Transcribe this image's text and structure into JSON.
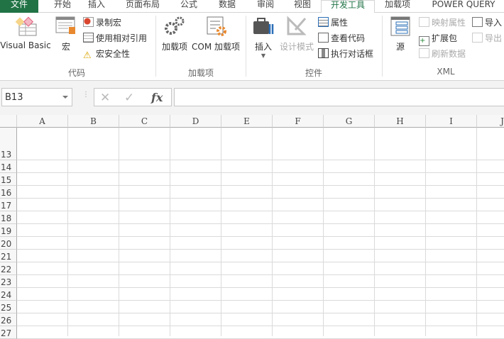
{
  "tabs": [
    "文件",
    "开始",
    "插入",
    "页面布局",
    "公式",
    "数据",
    "审阅",
    "视图",
    "开发工具",
    "加载项",
    "POWER QUERY"
  ],
  "active_tab": "开发工具",
  "ribbon": {
    "code": {
      "label": "代码",
      "visual_basic": "Visual Basic",
      "macros": "宏",
      "record_macro": "录制宏",
      "relative_ref": "使用相对引用",
      "macro_security": "宏安全性"
    },
    "addins": {
      "label": "加载项",
      "addins": "加载项",
      "com_addins": "COM 加载项"
    },
    "controls": {
      "label": "控件",
      "insert": "插入",
      "design_mode": "设计模式",
      "properties": "属性",
      "view_code": "查看代码",
      "run_dialog": "执行对话框"
    },
    "xml": {
      "label": "XML",
      "source": "源",
      "map_props": "映射属性",
      "expansion_packs": "扩展包",
      "refresh_data": "刷新数据",
      "import": "导入",
      "export": "导出"
    }
  },
  "formula_bar": {
    "name_box": "B13",
    "cancel": "✕",
    "enter": "✓",
    "fx": "fx",
    "value": ""
  },
  "columns": [
    "A",
    "B",
    "C",
    "D",
    "E",
    "F",
    "G",
    "H",
    "I",
    "J"
  ],
  "rows": [
    "13",
    "14",
    "15",
    "16",
    "17",
    "18",
    "19",
    "20",
    "21",
    "22",
    "23",
    "24",
    "25",
    "26",
    "27"
  ],
  "colors": {
    "accent": "#217346"
  }
}
